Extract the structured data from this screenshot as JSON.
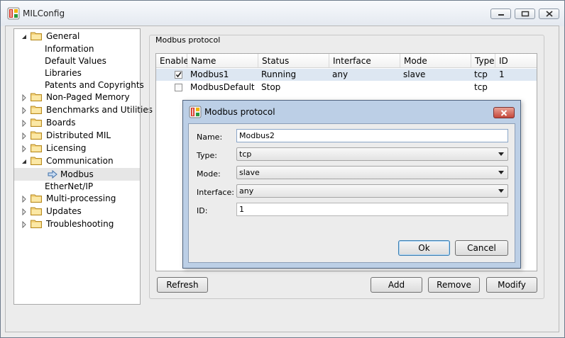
{
  "window": {
    "title": "MILConfig"
  },
  "tree": {
    "items": [
      {
        "label": "General",
        "expanded": true
      },
      {
        "label": "Information"
      },
      {
        "label": "Default Values"
      },
      {
        "label": "Libraries"
      },
      {
        "label": "Patents and Copyrights"
      },
      {
        "label": "Non-Paged Memory"
      },
      {
        "label": "Benchmarks and Utilities"
      },
      {
        "label": "Boards"
      },
      {
        "label": "Distributed MIL"
      },
      {
        "label": "Licensing"
      },
      {
        "label": "Communication",
        "expanded": true
      },
      {
        "label": "Modbus",
        "selected": true
      },
      {
        "label": "EtherNet/IP"
      },
      {
        "label": "Multi-processing"
      },
      {
        "label": "Updates"
      },
      {
        "label": "Troubleshooting"
      }
    ]
  },
  "group": {
    "label": "Modbus protocol"
  },
  "table": {
    "columns": [
      "Enable",
      "Name",
      "Status",
      "Interface",
      "Mode",
      "Type",
      "ID"
    ],
    "rows": [
      {
        "enabled": true,
        "name": "Modbus1",
        "status": "Running",
        "interface": "any",
        "mode": "slave",
        "type": "tcp",
        "id": "1"
      },
      {
        "enabled": false,
        "name": "ModbusDefault",
        "status": "Stop",
        "interface": "",
        "mode": "",
        "type": "tcp",
        "id": ""
      }
    ]
  },
  "buttons": {
    "refresh": "Refresh",
    "add": "Add",
    "remove": "Remove",
    "modify": "Modify"
  },
  "dialog": {
    "title": "Modbus protocol",
    "name_label": "Name:",
    "name_value": "Modbus2",
    "type_label": "Type:",
    "type_value": "tcp",
    "mode_label": "Mode:",
    "mode_value": "slave",
    "interface_label": "Interface:",
    "interface_value": "any",
    "id_label": "ID:",
    "id_value": "1",
    "ok": "Ok",
    "cancel": "Cancel"
  },
  "colors": {
    "selection": "#cce4f7",
    "tree_selection": "#e6e6e6",
    "close_button": "#c4473a",
    "dialog_frame": "#bccfe6"
  }
}
